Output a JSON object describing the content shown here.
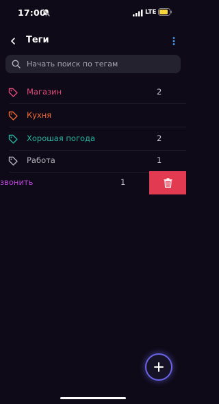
{
  "status": {
    "time": "17:00",
    "network": "LTE"
  },
  "header": {
    "title": "Теги"
  },
  "search": {
    "placeholder": "Начать поиск по тегам"
  },
  "tags": [
    {
      "name": "Магазин",
      "count": "2",
      "color": "#e24b79"
    },
    {
      "name": "Кухня",
      "count": "",
      "color": "#ef6a37"
    },
    {
      "name": "Хорошая погода",
      "count": "2",
      "color": "#27b3a0"
    },
    {
      "name": "Работа",
      "count": "1",
      "color": "#b6b3bd"
    }
  ],
  "swiped": {
    "name": "звонить",
    "count": "1",
    "color": "#b646d6",
    "action_color": "#e23a50"
  },
  "icons": {
    "back": "chevron-left-icon",
    "menu": "more-vertical-icon",
    "search": "search-icon",
    "tag": "tag-icon",
    "delete": "trash-icon",
    "add": "plus-icon",
    "silent": "bell-off-icon",
    "signal": "signal-icon",
    "battery": "battery-icon"
  },
  "colors": {
    "background": "#0f0a17",
    "fab_ring": "#6c63e6",
    "battery": "#f7d63c"
  }
}
